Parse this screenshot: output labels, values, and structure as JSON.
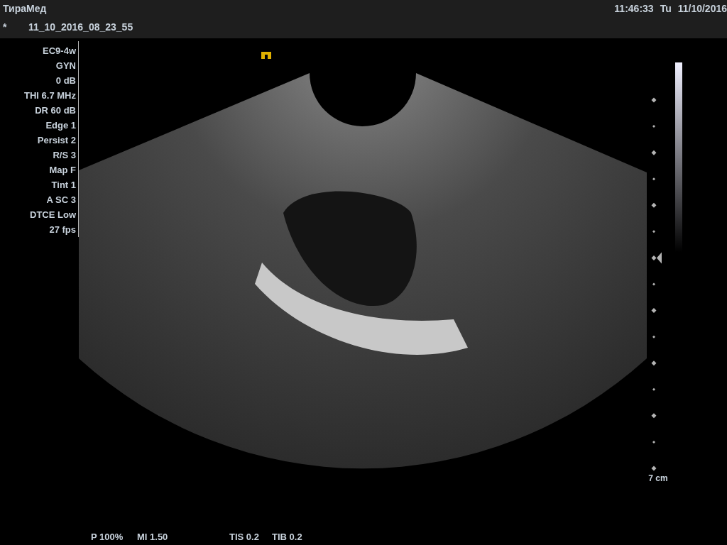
{
  "app_title": "ТираМед",
  "clock": {
    "time": "11:46:33",
    "day": "Tu",
    "date": "11/10/2016"
  },
  "study": {
    "marker": "*",
    "name": "11_10_2016_08_23_55"
  },
  "parameters": [
    "EC9-4w",
    "GYN",
    "0 dB",
    "THI 6.7 MHz",
    "DR 60 dB",
    "Edge 1",
    "Persist 2",
    "R/S 3",
    "Map F",
    "Tint 1",
    "A SC 3",
    "DTCE Low",
    "27 fps"
  ],
  "depth_scale": {
    "label": "7 cm"
  },
  "acoustic_output": [
    "P 100%",
    "MI 1.50",
    "TIS 0.2",
    "TIB 0.2"
  ]
}
